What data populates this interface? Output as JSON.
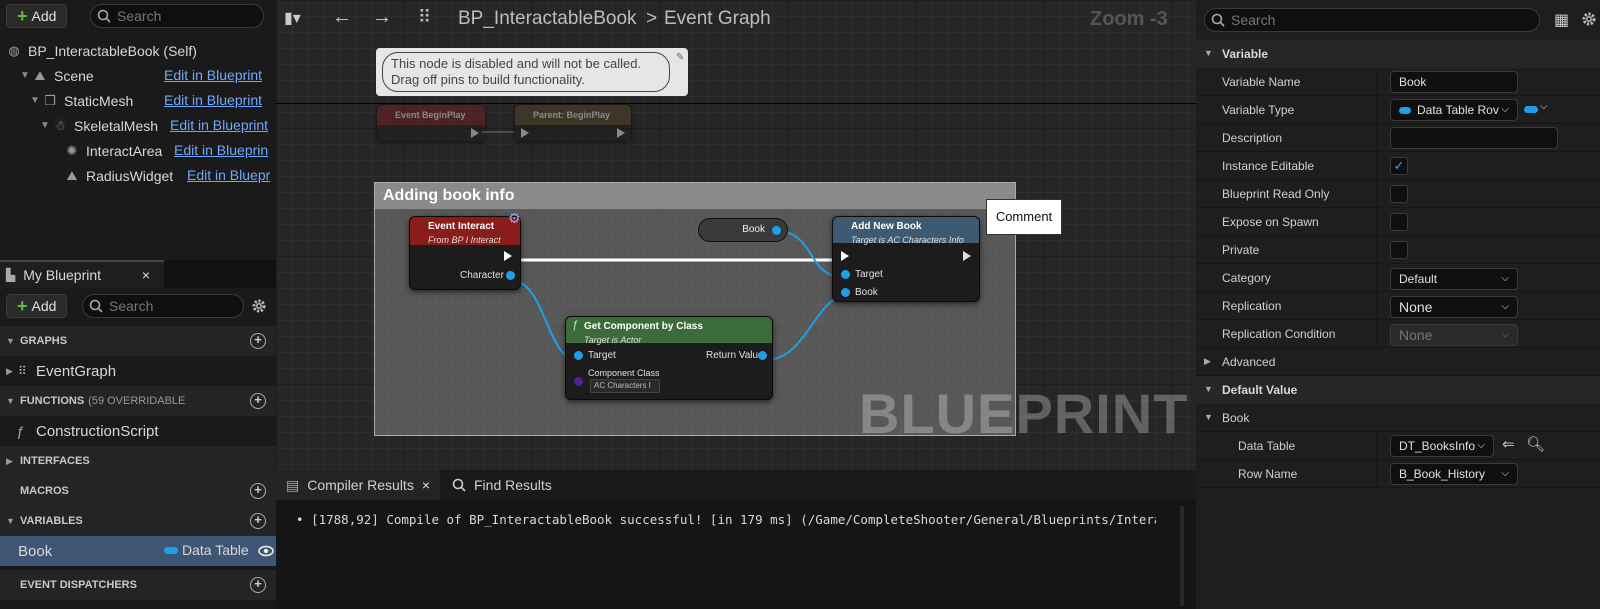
{
  "left": {
    "add_label": "Add",
    "search_placeholder": "Search",
    "tree": [
      {
        "label": "BP_InteractableBook (Self)"
      },
      {
        "label": "Scene",
        "link": "Edit in Blueprint"
      },
      {
        "label": "StaticMesh",
        "link": "Edit in Blueprint"
      },
      {
        "label": "SkeletalMesh",
        "link": "Edit in Blueprint"
      },
      {
        "label": "InteractArea",
        "link": "Edit in Blueprin"
      },
      {
        "label": "RadiusWidget",
        "link": "Edit in Bluepr"
      }
    ],
    "my_blueprint_tab": "My Blueprint",
    "close_glyph": "×",
    "add2_label": "Add",
    "search2_placeholder": "Search",
    "sections": {
      "graphs": "GRAPHS",
      "functions": "FUNCTIONS",
      "functions_overridable": "(59 OVERRIDABLE",
      "interfaces": "INTERFACES",
      "macros": "MACROS",
      "variables": "VARIABLES",
      "event_dispatchers": "EVENT DISPATCHERS"
    },
    "items": {
      "event_graph": "EventGraph",
      "construction_script": "ConstructionScript",
      "variable_name": "Book",
      "variable_type": "Data Table"
    }
  },
  "toolbar": {
    "breadcrumb_bp": "BP_InteractableBook",
    "breadcrumb_sep": ">",
    "breadcrumb_graph": "Event Graph",
    "zoom": "Zoom -3"
  },
  "graph": {
    "disabled_tooltip_line1": "This node is disabled and will not be called.",
    "disabled_tooltip_line2": "Drag off pins to build functionality.",
    "event_beginplay": "Event BeginPlay",
    "parent_beginplay": "Parent: BeginPlay",
    "comment_title": "Adding book info",
    "comment_button": "Comment",
    "event_interact_title": "Event Interact",
    "event_interact_sub": "From BP I Interact",
    "character_pin": "Character",
    "book_var": "Book",
    "add_new_book_title": "Add New Book",
    "add_new_book_sub": "Target is AC Characters Info",
    "target_pin": "Target",
    "book_pin": "Book",
    "get_component_title": "Get Component by Class",
    "get_component_sub": "Target is Actor",
    "gc_target_pin": "Target",
    "return_value_pin": "Return Value",
    "component_class_pin": "Component Class",
    "component_class_value": "AC Characters I",
    "watermark": "BLUEPRINT"
  },
  "bottom": {
    "compiler_tab": "Compiler Results",
    "find_tab": "Find Results",
    "log_line": "[1788,92] Compile of BP_InteractableBook successful! [in 179 ms] (/Game/CompleteShooter/General/Blueprints/Intera"
  },
  "details": {
    "search_placeholder": "Search",
    "variable_hdr": "Variable",
    "rows": {
      "variable_name_lbl": "Variable Name",
      "variable_name_val": "Book",
      "variable_type_lbl": "Variable Type",
      "variable_type_val": "Data Table Rov",
      "description_lbl": "Description",
      "instance_editable_lbl": "Instance Editable",
      "bp_read_only_lbl": "Blueprint Read Only",
      "expose_spawn_lbl": "Expose on Spawn",
      "private_lbl": "Private",
      "category_lbl": "Category",
      "category_val": "Default",
      "replication_lbl": "Replication",
      "replication_val": "None",
      "replication_cond_lbl": "Replication Condition",
      "replication_cond_val": "None"
    },
    "advanced_hdr": "Advanced",
    "default_value_hdr": "Default Value",
    "book_hdr": "Book",
    "data_table_lbl": "Data Table",
    "data_table_val": "DT_BooksInfo",
    "row_name_lbl": "Row Name",
    "row_name_val": "B_Book_History",
    "checks": {
      "instance_editable": true,
      "bp_read_only": false,
      "expose_spawn": false,
      "private": false
    }
  },
  "colors": {
    "accent_blue": "#1f9fe8",
    "event_red": "#8a1c1c",
    "function_green": "#3c6b3a",
    "link": "#6fa8ff"
  }
}
